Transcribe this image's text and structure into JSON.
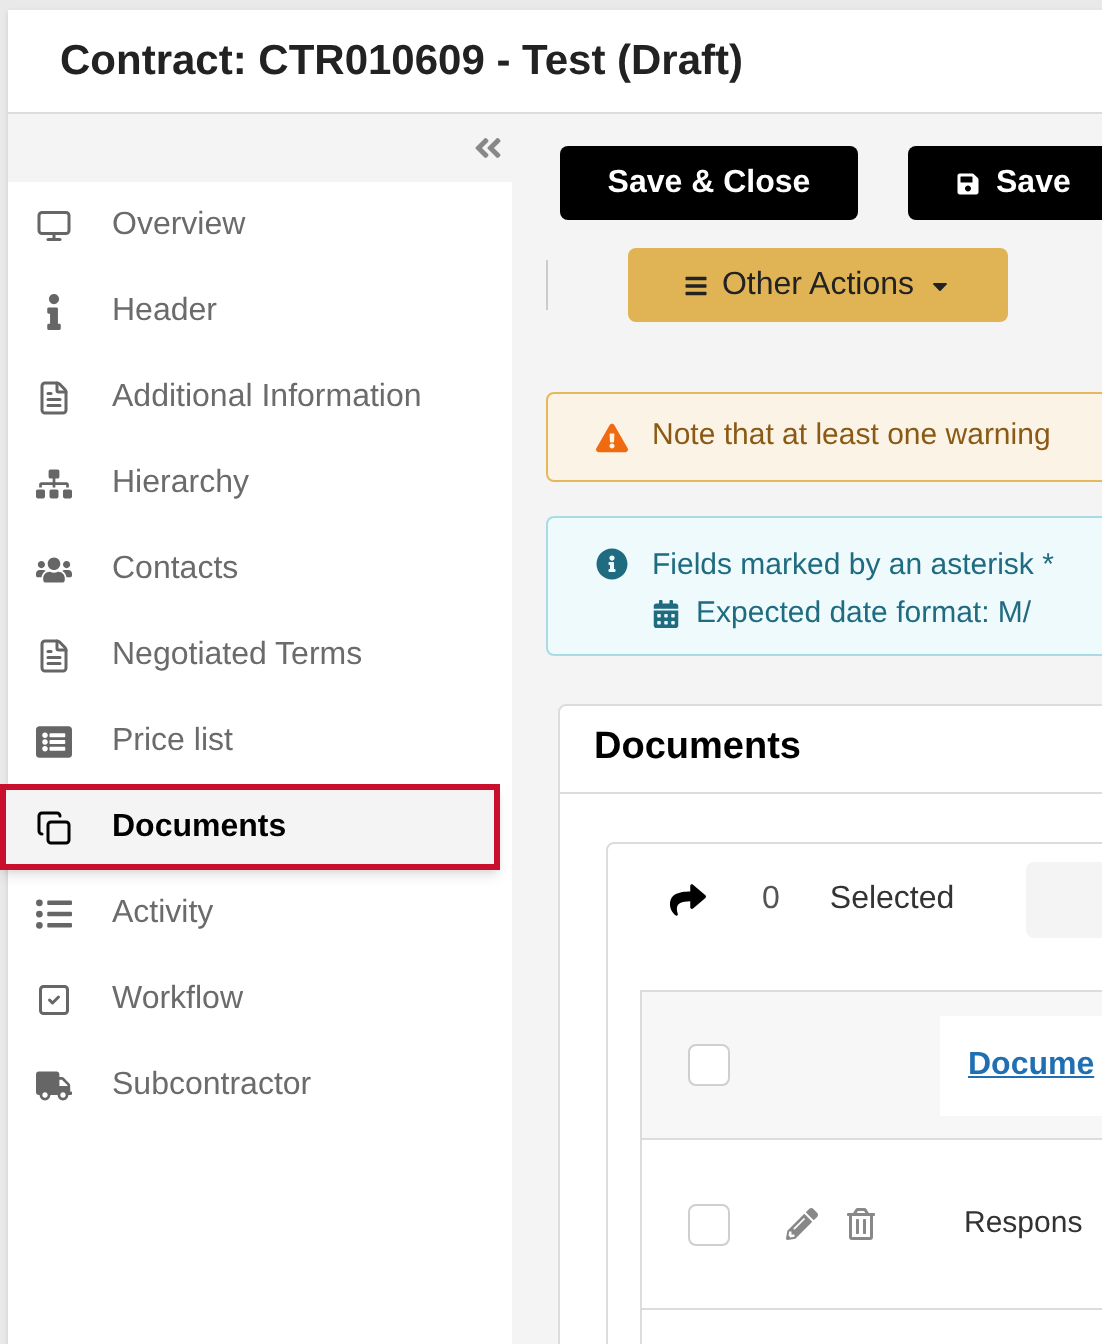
{
  "window": {
    "title": "Contract: CTR010609 - Test (Draft)"
  },
  "sidebar": {
    "items": [
      {
        "label": "Overview",
        "selected": false
      },
      {
        "label": "Header",
        "selected": false
      },
      {
        "label": "Additional Information",
        "selected": false
      },
      {
        "label": "Hierarchy",
        "selected": false
      },
      {
        "label": "Contacts",
        "selected": false
      },
      {
        "label": "Negotiated Terms",
        "selected": false
      },
      {
        "label": "Price list",
        "selected": false
      },
      {
        "label": "Documents",
        "selected": true
      },
      {
        "label": "Activity",
        "selected": false
      },
      {
        "label": "Workflow",
        "selected": false
      },
      {
        "label": "Subcontractor",
        "selected": false
      }
    ]
  },
  "toolbar": {
    "buttons": [
      "Save & Close",
      "Save"
    ],
    "other_actions": "Other Actions"
  },
  "alerts": [
    {
      "kind": "warning",
      "lines": [
        "Note that at least one warning"
      ]
    },
    {
      "kind": "info",
      "lines": [
        "Fields marked by an asterisk *",
        "Expected date format: M/"
      ]
    }
  ],
  "documents": {
    "title": "Documents",
    "selected_count": "0",
    "selected_label": "Selected",
    "table": {
      "header_checked": false,
      "columns": [
        "Docume"
      ],
      "rows": [
        {
          "checked": false,
          "cells": [
            "Respons"
          ]
        }
      ]
    }
  }
}
